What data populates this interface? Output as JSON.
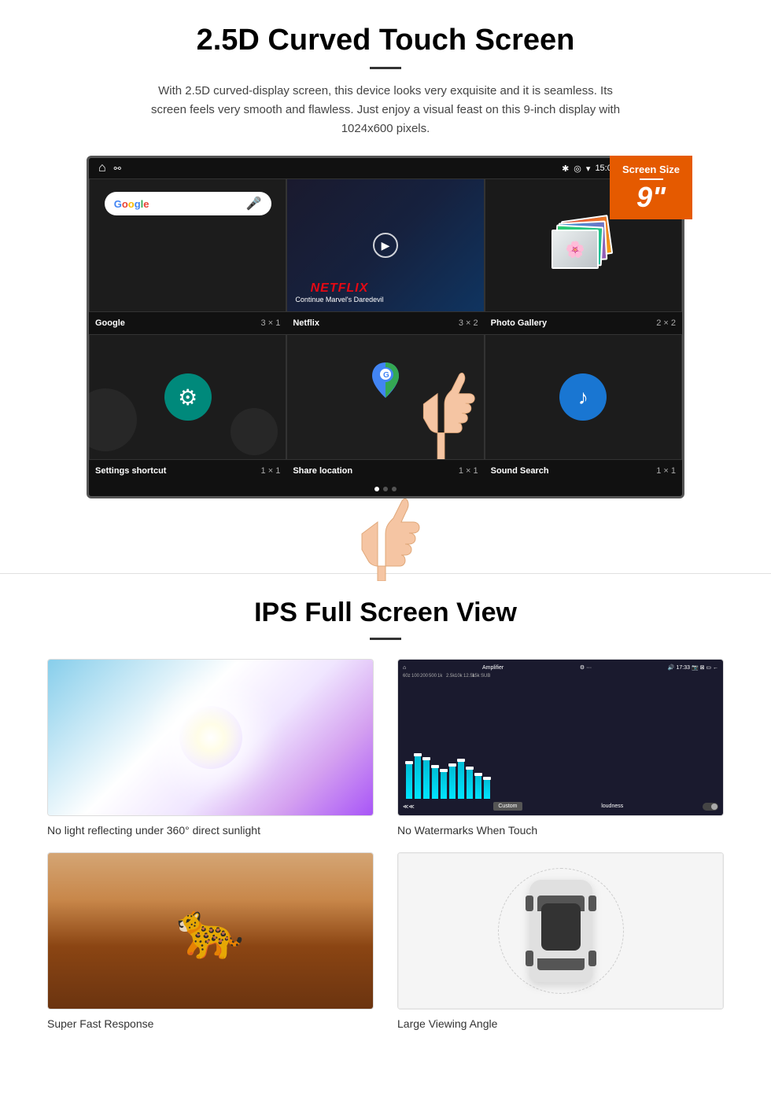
{
  "section1": {
    "title": "2.5D Curved Touch Screen",
    "description": "With 2.5D curved-display screen, this device looks very exquisite and it is seamless. Its screen feels very smooth and flawless. Just enjoy a visual feast on this 9-inch display with 1024x600 pixels.",
    "badge": {
      "label": "Screen Size",
      "size": "9\""
    },
    "status_bar": {
      "time": "15:06"
    },
    "apps_row1": [
      {
        "name": "Google",
        "size": "3 × 1"
      },
      {
        "name": "Netflix",
        "size": "3 × 2"
      },
      {
        "name": "Photo Gallery",
        "size": "2 × 2"
      }
    ],
    "apps_row2": [
      {
        "name": "Settings shortcut",
        "size": "1 × 1"
      },
      {
        "name": "Share location",
        "size": "1 × 1"
      },
      {
        "name": "Sound Search",
        "size": "1 × 1"
      }
    ],
    "netflix": {
      "logo": "NETFLIX",
      "subtitle": "Continue Marvel's Daredevil"
    }
  },
  "section2": {
    "title": "IPS Full Screen View",
    "features": [
      {
        "caption": "No light reflecting under 360° direct sunlight",
        "type": "sunlight"
      },
      {
        "caption": "No Watermarks When Touch",
        "type": "amplifier"
      },
      {
        "caption": "Super Fast Response",
        "type": "cheetah"
      },
      {
        "caption": "Large Viewing Angle",
        "type": "car"
      }
    ]
  }
}
